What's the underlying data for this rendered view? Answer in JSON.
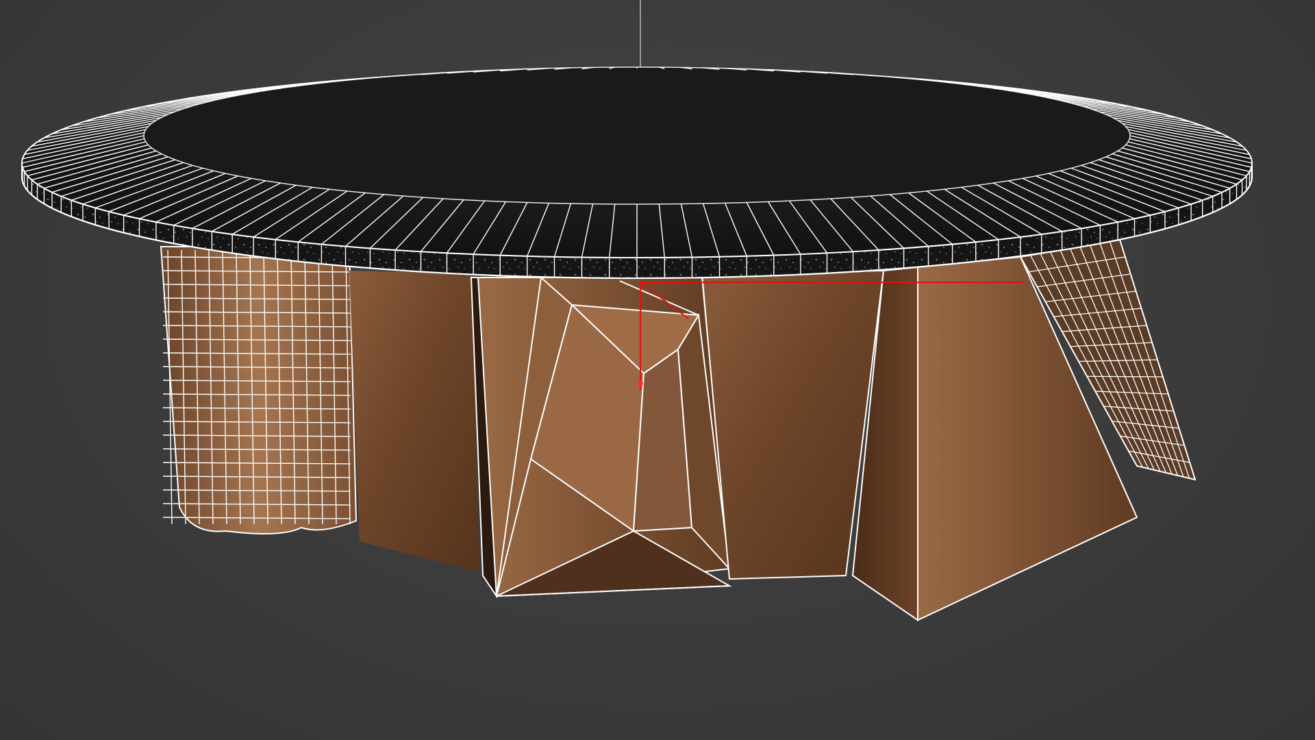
{
  "viewport": {
    "background": "#3a3a3a",
    "wireframe_color": "#ffffff",
    "axis_x_color": "#e01010",
    "axis_y_color": "#e01010",
    "axis_z_color": "#bdbdbd"
  },
  "model": {
    "object": "round-table",
    "top_material_color": "#141414",
    "edge_material_color": "#1c1c1c",
    "base_material_color": "#7a5234",
    "wireframe_on_shaded": true
  }
}
